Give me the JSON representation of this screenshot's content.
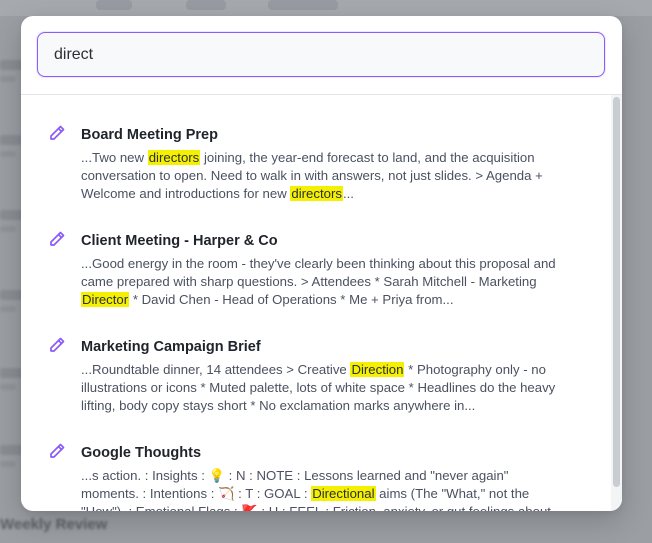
{
  "search": {
    "value": "direct"
  },
  "results": [
    {
      "title": "Board Meeting Prep",
      "lines": [
        [
          "...Two new ",
          {
            "hl": "directors"
          },
          " joining, the year-end forecast to land, and the acquisition"
        ],
        [
          "conversation to open. Need to walk in with answers, not just slides. > Agenda +"
        ],
        [
          "Welcome and introductions for new ",
          {
            "hl": "directors"
          },
          "..."
        ]
      ]
    },
    {
      "title": "Client Meeting - Harper & Co",
      "lines": [
        [
          "...Good energy in the room - they've clearly been thinking about this proposal and"
        ],
        [
          "came prepared with sharp questions. > Attendees * Sarah Mitchell - Marketing"
        ],
        [
          {
            "hl": "Director"
          },
          " * David Chen - Head of Operations * Me + Priya from..."
        ]
      ]
    },
    {
      "title": "Marketing Campaign Brief",
      "lines": [
        [
          "...Roundtable dinner, 14 attendees > Creative ",
          {
            "hl": "Direction"
          },
          " * Photography only - no"
        ],
        [
          "illustrations or icons * Muted palette, lots of white space * Headlines do the heavy"
        ],
        [
          "lifting, body copy stays short * No exclamation marks anywhere in..."
        ]
      ]
    },
    {
      "title": "Google Thoughts",
      "lines": [
        [
          "...s action. : Insights : 💡 : N : NOTE : Lessons learned and \"never again\""
        ],
        [
          "moments. : Intentions : 🏹 : T : GOAL : ",
          {
            "hl": "Directional"
          },
          " aims (The \"What,\" not the"
        ],
        [
          "\"How\"). : Emotional Flags : 🚩 : H : FEEL : Friction, anxiety, or gut feelings about..."
        ]
      ]
    }
  ],
  "background": {
    "bottom_label": "Weekly Review"
  },
  "colors": {
    "accent": "#8b5cf6",
    "highlight": "#f5f000"
  },
  "icons": {
    "result": "pencil-icon"
  }
}
